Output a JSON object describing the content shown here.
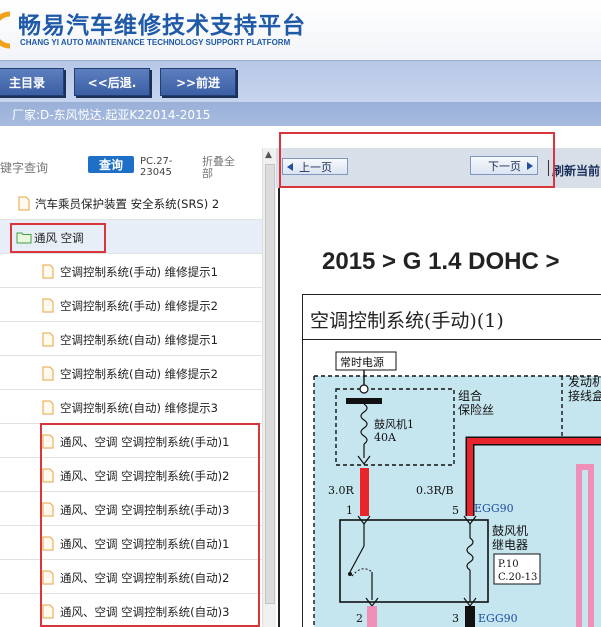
{
  "header": {
    "title": "畅易汽车维修技术支持平台",
    "subtitle": "CHANG YI AUTO MAINTENANCE TECHNOLOGY SUPPORT PLATFORM"
  },
  "nav": {
    "main_label": "主目录",
    "back_label": "<<后退.",
    "forward_label": ">>前进"
  },
  "vendor": {
    "text": "厂家:D-东风悦达.起亚K22014-2015"
  },
  "search": {
    "keyword_label": "键字查询",
    "query_button": "查询",
    "pc_text": "PC.27-23045",
    "collapse_all": "折叠全部"
  },
  "tree": {
    "items": [
      {
        "label": "汽车乘员保护装置 安全系统(SRS) 2",
        "type": "doc"
      },
      {
        "label": "通风 空调",
        "type": "folder"
      },
      {
        "label": "空调控制系统(手动) 维修提示1",
        "type": "doc"
      },
      {
        "label": "空调控制系统(手动) 维修提示2",
        "type": "doc"
      },
      {
        "label": "空调控制系统(自动) 维修提示1",
        "type": "doc"
      },
      {
        "label": "空调控制系统(自动) 维修提示2",
        "type": "doc"
      },
      {
        "label": "空调控制系统(自动) 维修提示3",
        "type": "doc"
      },
      {
        "label": "通风、空调 空调控制系统(手动)1",
        "type": "doc"
      },
      {
        "label": "通风、空调 空调控制系统(手动)2",
        "type": "doc"
      },
      {
        "label": "通风、空调 空调控制系统(手动)3",
        "type": "doc"
      },
      {
        "label": "通风、空调 空调控制系统(自动)1",
        "type": "doc"
      },
      {
        "label": "通风、空调 空调控制系统(自动)2",
        "type": "doc"
      },
      {
        "label": "通风、空调 空调控制系统(自动)3",
        "type": "doc"
      }
    ]
  },
  "pager": {
    "prev_label": "上一页",
    "next_label": "下一页",
    "refresh_label": "刷新当前"
  },
  "content": {
    "heading": "2015 > G 1.4 DOHC >",
    "subheading": "空调控制系统(手动)(1)"
  },
  "diagram": {
    "constant_power": "常时电源",
    "fuse_box_1": "组合",
    "fuse_box_2": "保险丝",
    "engine_box_1": "发动机",
    "engine_box_2": "接线盒",
    "fuse_name": "鼓风机1",
    "fuse_rating": "40A",
    "wire_left": "3.0R",
    "wire_right": "0.3R/B",
    "pin_1": "1",
    "pin_5": "5",
    "pin_2": "2",
    "pin_3": "3",
    "ground_top": "EGG90",
    "ground_bottom": "EGG90",
    "relay_1": "鼓风机",
    "relay_2": "继电器",
    "ref_1": "P.10",
    "ref_2": "C.20-13"
  },
  "colors": {
    "brand_blue": "#1e5aa8",
    "annotation_red": "#d9353b",
    "wire_red": "#e8242c",
    "wire_pink": "#f08fb8",
    "diagram_fill": "#c6e6ef"
  }
}
